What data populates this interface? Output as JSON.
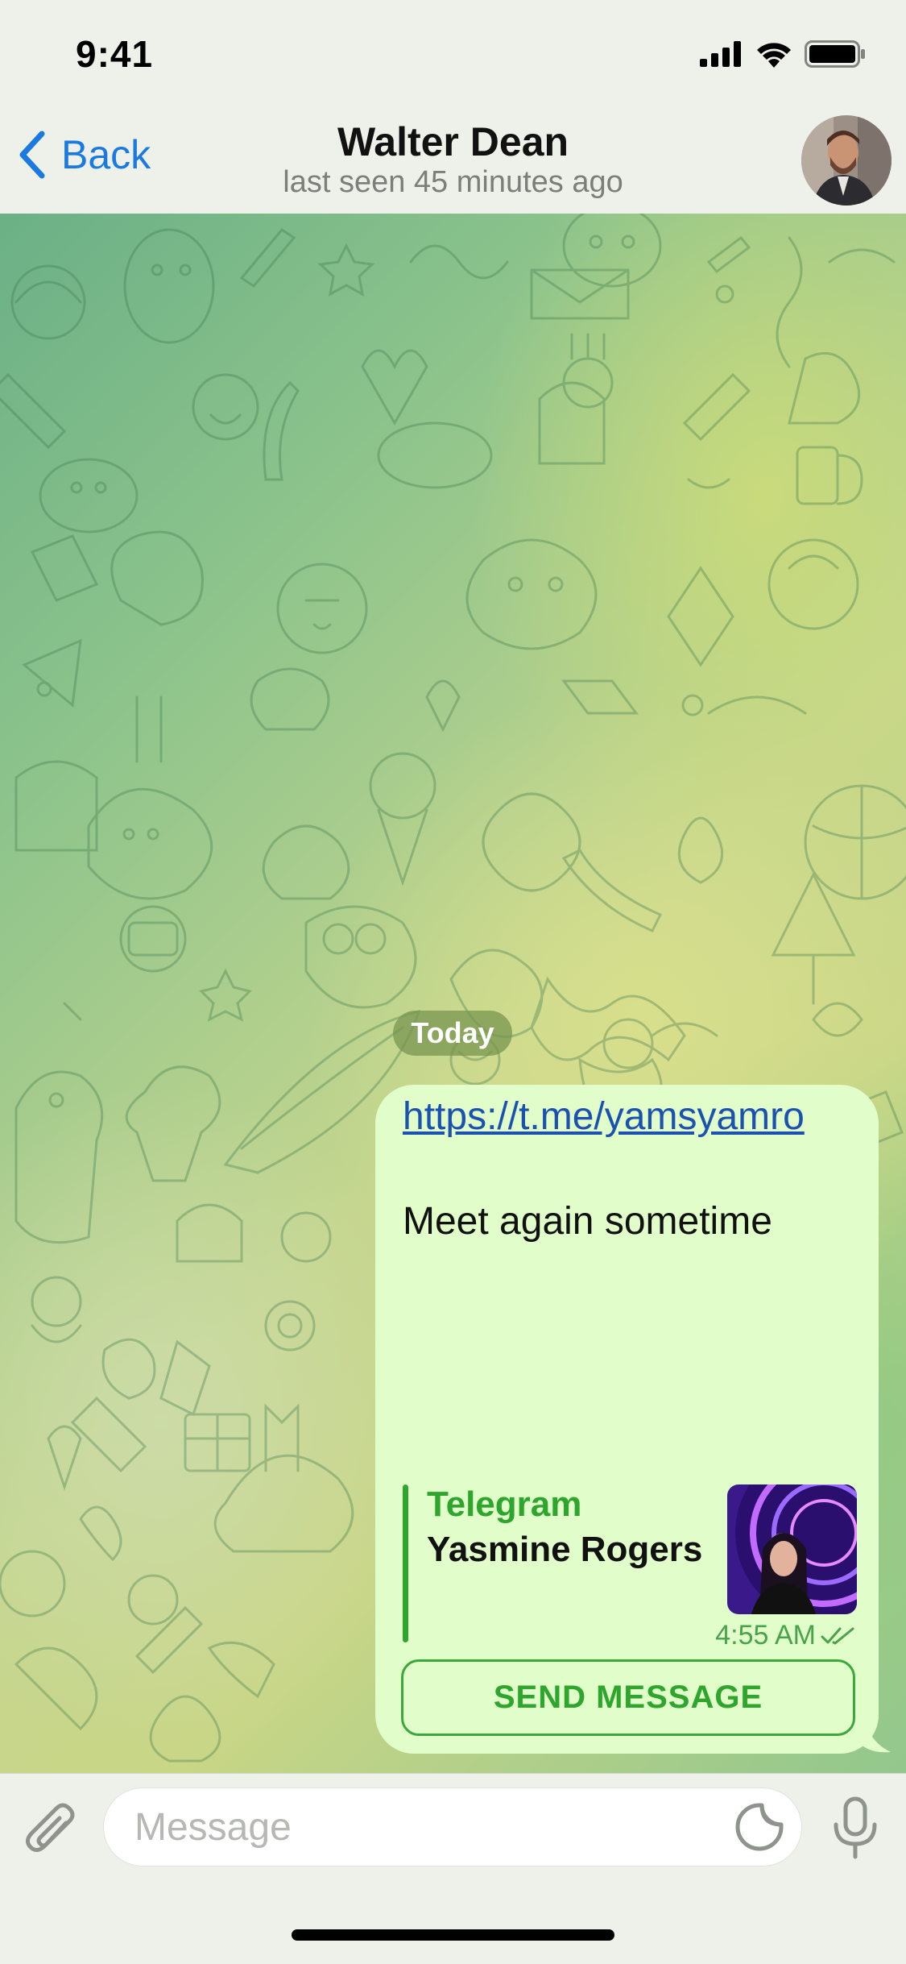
{
  "status_bar": {
    "time": "9:41"
  },
  "nav": {
    "back_label": "Back",
    "title": "Walter Dean",
    "subtitle": "last seen 45 minutes ago"
  },
  "chat": {
    "date_label": "Today",
    "message": {
      "link": "https://t.me/yamsyamro",
      "text": "Meet again sometime",
      "preview_site": "Telegram",
      "preview_title": "Yasmine Rogers",
      "time": "4:55 AM",
      "status": "read",
      "action_button": "SEND MESSAGE"
    }
  },
  "input": {
    "placeholder": "Message"
  },
  "colors": {
    "accent": "#1a7ae0",
    "bubble": "#e1fdc9",
    "outgoing_green": "#2ea52c",
    "link": "#1b52b0"
  },
  "icons": {
    "back": "chevron-left-icon",
    "attach": "paperclip-icon",
    "sticker": "sticker-icon",
    "mic": "microphone-icon",
    "read_receipt": "double-check-icon"
  }
}
